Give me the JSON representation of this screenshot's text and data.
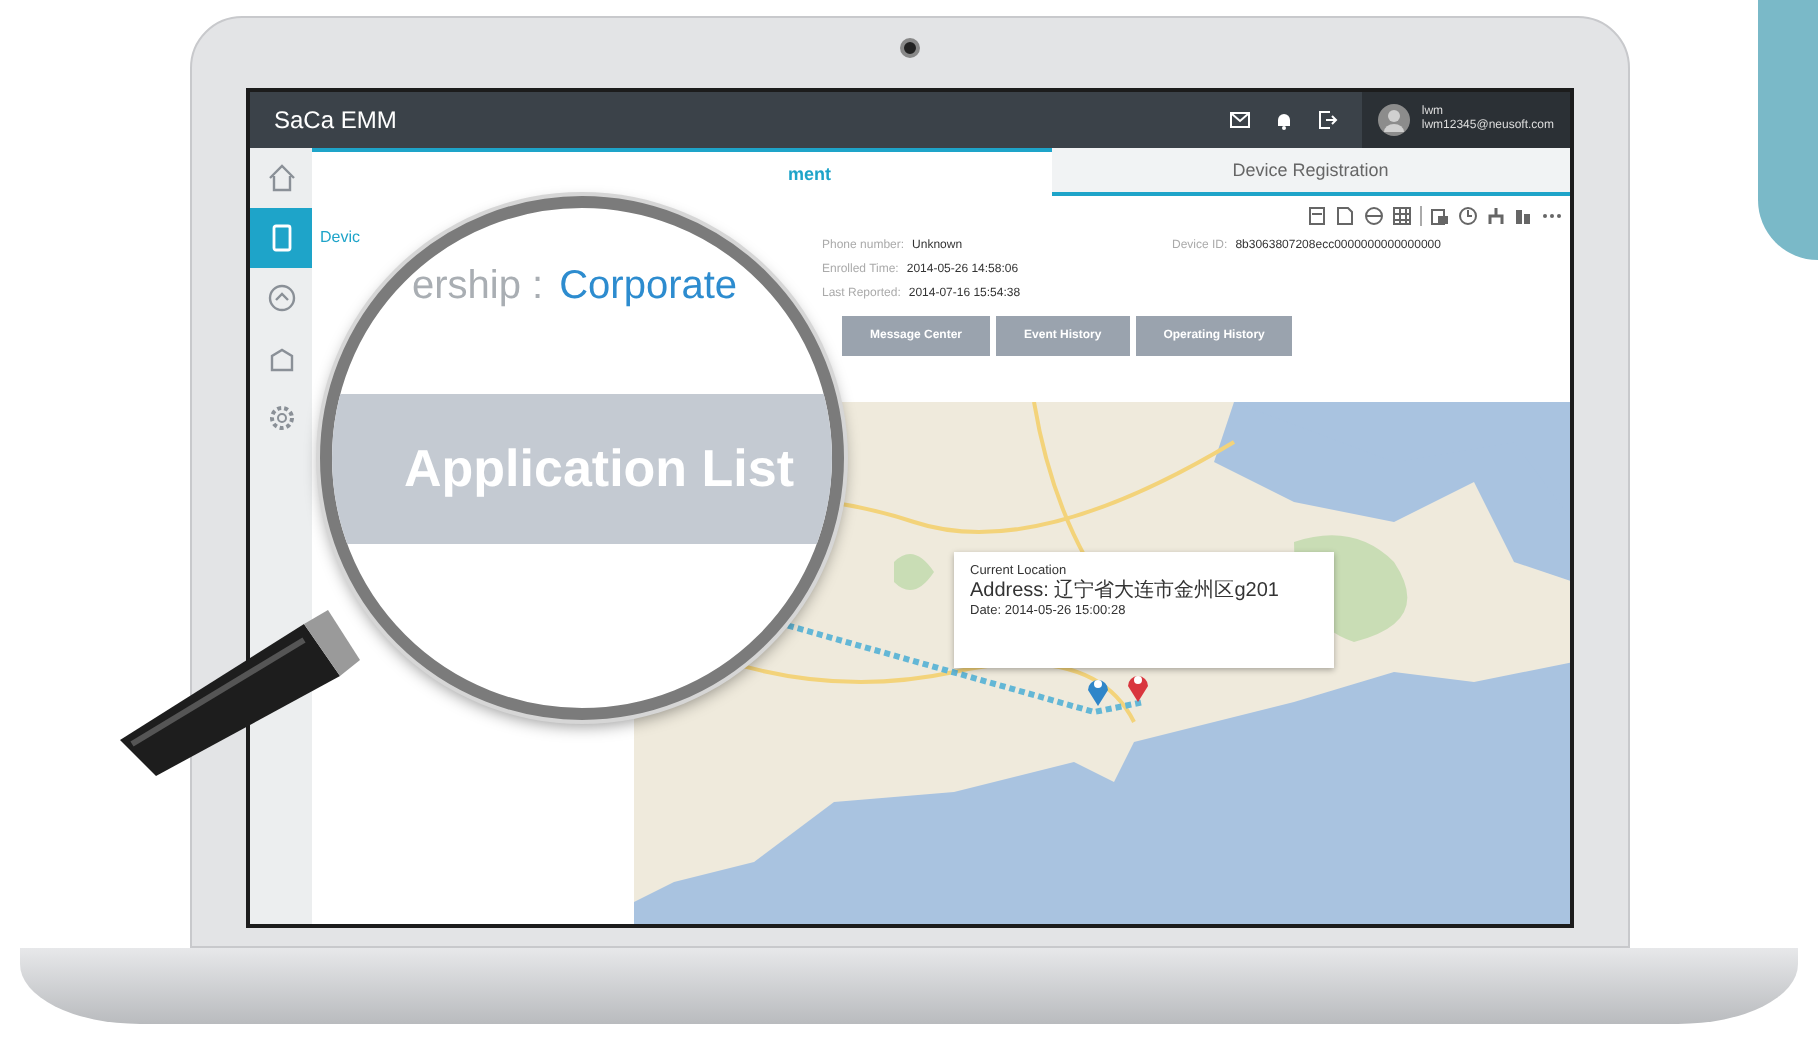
{
  "header": {
    "logo": "SaCa EMM",
    "user": {
      "name": "lwm",
      "email": "lwm12345@neusoft.com"
    }
  },
  "sidebar": {
    "items": [
      {
        "selected": false
      },
      {
        "selected": true
      },
      {
        "selected": false
      },
      {
        "selected": false
      },
      {
        "selected": false
      }
    ]
  },
  "tabs": [
    {
      "label": "ment",
      "selected": true
    },
    {
      "label": "Device Registration",
      "selected": false
    }
  ],
  "breadcrumb": "Devic",
  "info": [
    {
      "label": "Phone number:",
      "value": "Unknown"
    },
    {
      "label": "Device ID:",
      "value": "8b3063807208ecc0000000000000000"
    },
    {
      "label": "Enrolled Time:",
      "value": "2014-05-26 14:58:06"
    },
    {
      "label": "Last Reported:",
      "value": "2014-07-16 15:54:38"
    }
  ],
  "sub_tabs": [
    {
      "label": "Message Center",
      "selected": false
    },
    {
      "label": "Event History",
      "selected": false
    },
    {
      "label": "Operating History",
      "selected": false
    }
  ],
  "map_popup": {
    "title": "Current Location",
    "address": "Address: 辽宁省大连市金州区g201",
    "date": "Date: 2014-05-26 15:00:28"
  },
  "magnifier": {
    "ownership_label": "ership :",
    "ownership_value": "Corporate",
    "section": "Application List"
  }
}
